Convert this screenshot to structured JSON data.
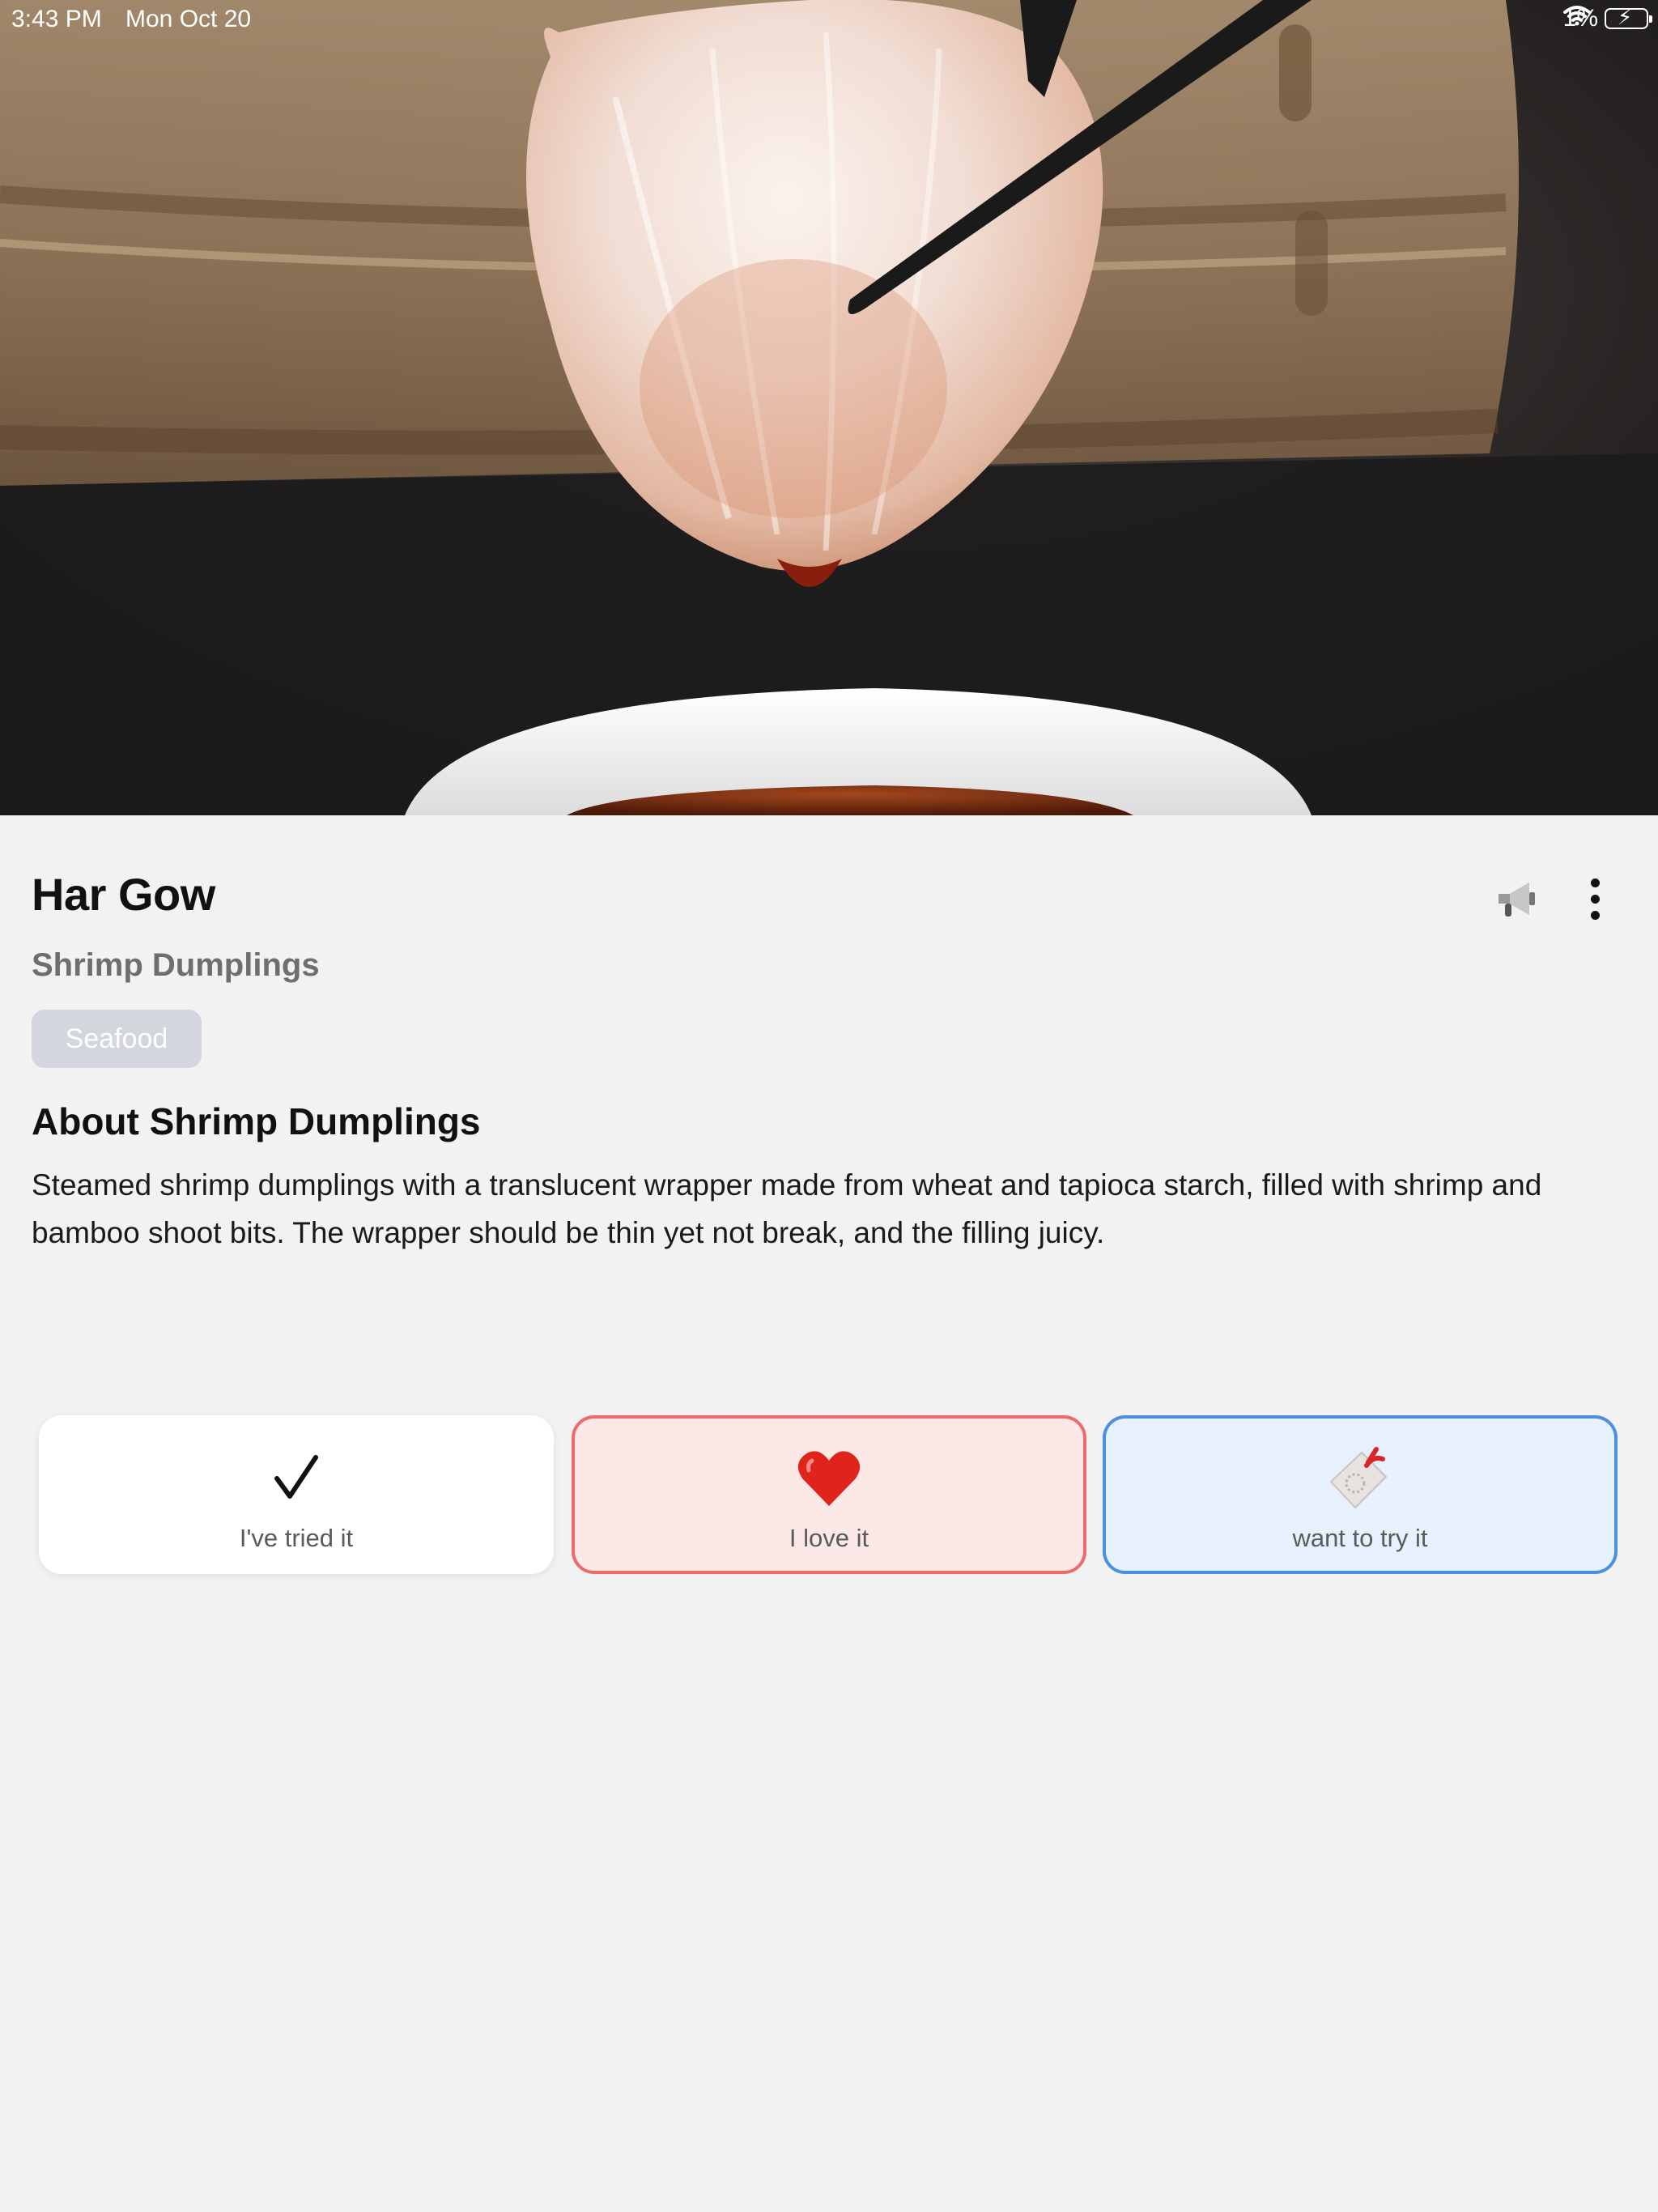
{
  "status_bar": {
    "time": "3:43 PM",
    "date": "Mon Oct 20",
    "battery": "1%"
  },
  "dish": {
    "name": "Har Gow",
    "english_name": "Shrimp Dumplings",
    "tag": "Seafood",
    "about_heading": "About Shrimp Dumplings",
    "description": "Steamed shrimp dumplings with a translucent wrapper made from wheat and tapioca starch, filled with shrimp and bamboo shoot bits. The wrapper should be thin yet not break, and the filling juicy."
  },
  "header_actions": {
    "speaker_icon": "speaker-icon",
    "more_icon": "more-vertical-icon"
  },
  "actions": [
    {
      "label": "I've tried it",
      "icon": "checkmark-icon",
      "color": "#ffffff"
    },
    {
      "label": "I love it",
      "icon": "heart-icon",
      "color": "#ee6b6b"
    },
    {
      "label": "want to try it",
      "icon": "bookmark-tag-icon",
      "color": "#4a8fe0"
    }
  ],
  "colors": {
    "background": "#f2f2f2",
    "tag_bg": "#d3d6dc",
    "love_border": "#ee6b6b",
    "want_border": "#4a8fe0"
  }
}
